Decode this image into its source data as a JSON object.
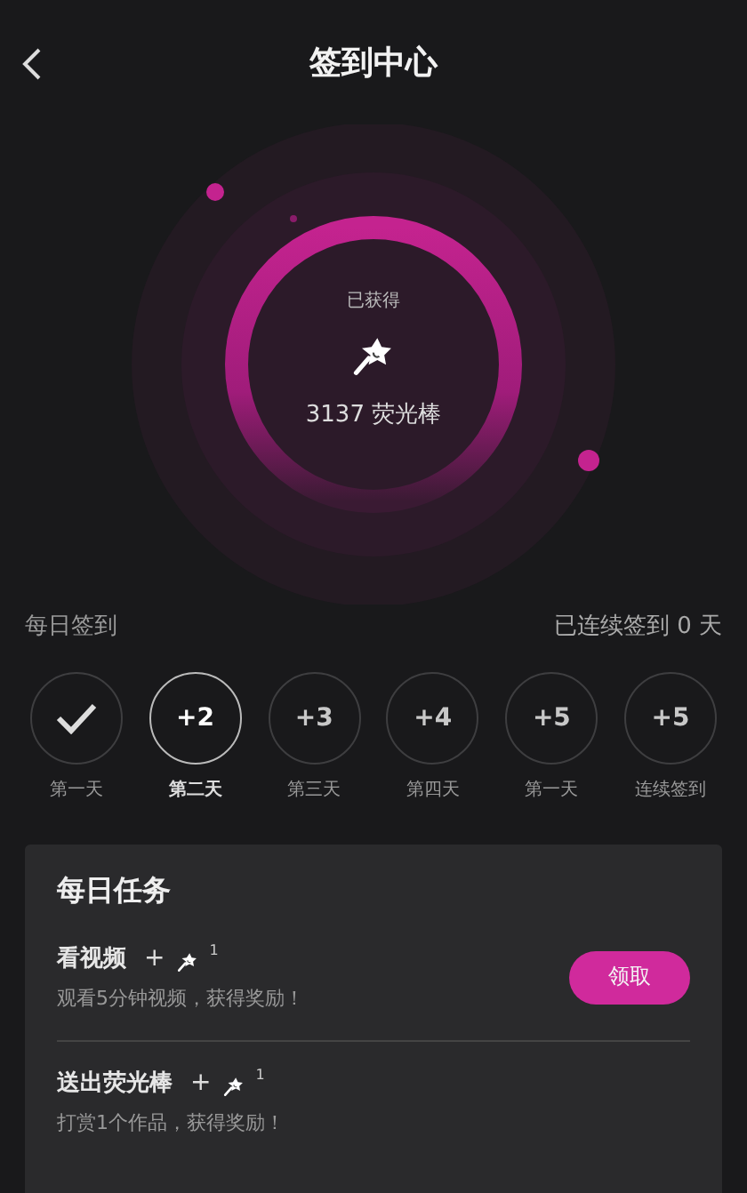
{
  "header": {
    "title": "签到中心"
  },
  "summary": {
    "caption": "已获得",
    "amount": "3137 荧光棒"
  },
  "checkin": {
    "title": "每日签到",
    "streak": "已连续签到 0 天",
    "days": [
      {
        "label": "第一天",
        "checked": true,
        "selected": false
      },
      {
        "reward": "+2",
        "label": "第二天",
        "checked": false,
        "selected": true
      },
      {
        "reward": "+3",
        "label": "第三天",
        "checked": false,
        "selected": false
      },
      {
        "reward": "+4",
        "label": "第四天",
        "checked": false,
        "selected": false
      },
      {
        "reward": "+5",
        "label": "第一天",
        "checked": false,
        "selected": false
      },
      {
        "reward": "+5",
        "label": "连续签到",
        "checked": false,
        "selected": false
      }
    ]
  },
  "tasks": {
    "title": "每日任务",
    "items": [
      {
        "name": "看视频",
        "plus": "+",
        "amount": "1",
        "description": "观看5分钟视频，获得奖励！",
        "button": "领取"
      },
      {
        "name": "送出荧光棒",
        "plus": "+",
        "amount": "1",
        "description": "打赏1个作品，获得奖励！"
      }
    ]
  }
}
